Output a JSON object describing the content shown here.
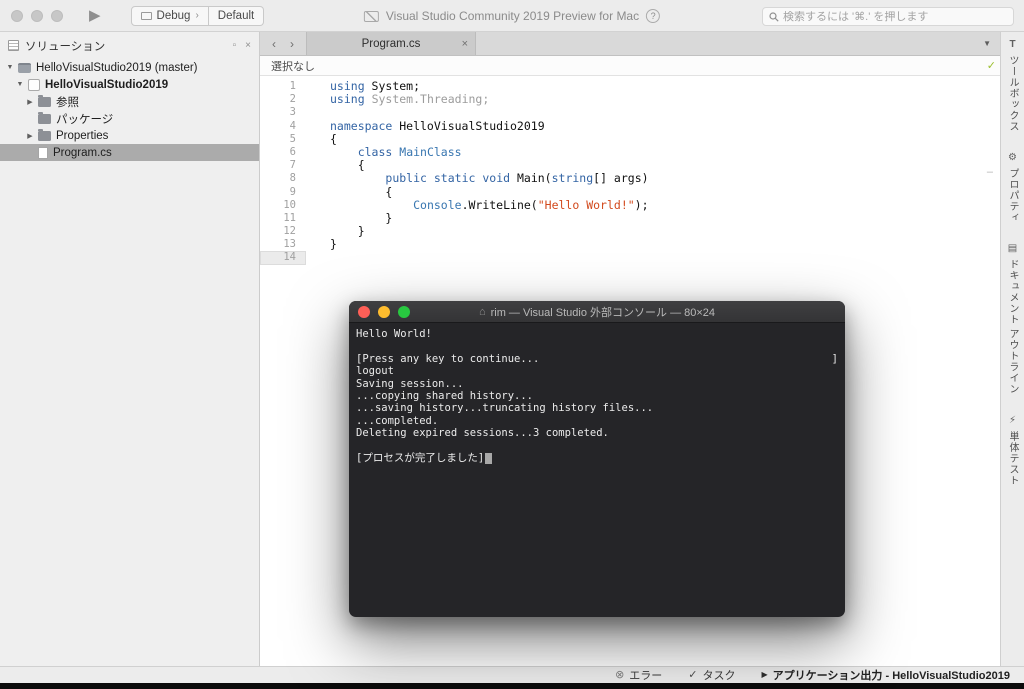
{
  "colors": {
    "kw": "#3364a4",
    "type": "#3876b0",
    "str": "#d2491c",
    "dim": "#9c9c9c",
    "plain": "#111111",
    "selection": "#ababab",
    "check": "#9bbf2e",
    "light-red": "#ff5f57",
    "light-yellow": "#febc2e",
    "light-green": "#28c840"
  },
  "glyphs": {
    "play": "▶",
    "help": "?",
    "back": "‹",
    "forward": "›",
    "close": "×",
    "tab_menu": "▼",
    "dock": "▫",
    "house": "⌂",
    "check": "✓",
    "dash": "–",
    "debug_chevron": "›"
  },
  "titlebar": {
    "title": "Visual Studio Community 2019 Preview for Mac",
    "debug_label": "Debug",
    "config_label": "Default",
    "search_placeholder": "検索するには '⌘.' を押します"
  },
  "sidebar": {
    "header": "ソリューション",
    "tree": [
      {
        "id": "solution",
        "label": "HelloVisualStudio2019 (master)",
        "indent": 0,
        "arrow": "down",
        "icon": "solution"
      },
      {
        "id": "project",
        "label": "HelloVisualStudio2019",
        "indent": 1,
        "arrow": "down",
        "icon": "project",
        "bold": true
      },
      {
        "id": "references",
        "label": "参照",
        "indent": 2,
        "arrow": "right",
        "icon": "folder"
      },
      {
        "id": "packages",
        "label": "パッケージ",
        "indent": 2,
        "arrow": "none",
        "icon": "folder"
      },
      {
        "id": "properties",
        "label": "Properties",
        "indent": 2,
        "arrow": "right",
        "icon": "folder"
      },
      {
        "id": "program-cs",
        "label": "Program.cs",
        "indent": 2,
        "arrow": "none",
        "icon": "file",
        "selected": true
      }
    ]
  },
  "editor": {
    "tab_title": "Program.cs",
    "breadcrumb": "選択なし",
    "lines": [
      {
        "n": 1,
        "tokens": [
          {
            "c": "kw",
            "t": "using"
          },
          {
            "c": "plain",
            "t": " System;"
          }
        ]
      },
      {
        "n": 2,
        "tokens": [
          {
            "c": "kw",
            "t": "using"
          },
          {
            "c": "plain",
            "t": " "
          },
          {
            "c": "dim",
            "t": "System.Threading;"
          }
        ]
      },
      {
        "n": 3,
        "tokens": []
      },
      {
        "n": 4,
        "tokens": [
          {
            "c": "kw",
            "t": "namespace"
          },
          {
            "c": "plain",
            "t": " HelloVisualStudio2019"
          }
        ]
      },
      {
        "n": 5,
        "tokens": [
          {
            "c": "plain",
            "t": "{"
          }
        ]
      },
      {
        "n": 6,
        "tokens": [
          {
            "c": "plain",
            "t": "    "
          },
          {
            "c": "kw",
            "t": "class"
          },
          {
            "c": "plain",
            "t": " "
          },
          {
            "c": "type",
            "t": "MainClass"
          }
        ]
      },
      {
        "n": 7,
        "tokens": [
          {
            "c": "plain",
            "t": "    {"
          }
        ]
      },
      {
        "n": 8,
        "tokens": [
          {
            "c": "plain",
            "t": "        "
          },
          {
            "c": "kw",
            "t": "public"
          },
          {
            "c": "plain",
            "t": " "
          },
          {
            "c": "kw",
            "t": "static"
          },
          {
            "c": "plain",
            "t": " "
          },
          {
            "c": "kw",
            "t": "void"
          },
          {
            "c": "plain",
            "t": " Main("
          },
          {
            "c": "kw",
            "t": "string"
          },
          {
            "c": "plain",
            "t": "[] args)"
          }
        ]
      },
      {
        "n": 9,
        "tokens": [
          {
            "c": "plain",
            "t": "        {"
          }
        ]
      },
      {
        "n": 10,
        "tokens": [
          {
            "c": "plain",
            "t": "            "
          },
          {
            "c": "type",
            "t": "Console"
          },
          {
            "c": "plain",
            "t": ".WriteLine("
          },
          {
            "c": "str",
            "t": "\"Hello World!\""
          },
          {
            "c": "plain",
            "t": ");"
          }
        ]
      },
      {
        "n": 11,
        "tokens": [
          {
            "c": "plain",
            "t": "        }"
          }
        ]
      },
      {
        "n": 12,
        "tokens": [
          {
            "c": "plain",
            "t": "    }"
          }
        ]
      },
      {
        "n": 13,
        "tokens": [
          {
            "c": "plain",
            "t": "}"
          }
        ]
      },
      {
        "n": 14,
        "tokens": [],
        "current": true
      }
    ]
  },
  "terminal": {
    "title": "rim — Visual Studio 外部コンソール — 80×24",
    "lines": [
      {
        "text": "Hello World!"
      },
      {
        "text": ""
      },
      {
        "text": "[Press any key to continue...",
        "right": "]"
      },
      {
        "text": "logout"
      },
      {
        "text": "Saving session..."
      },
      {
        "text": "...copying shared history..."
      },
      {
        "text": "...saving history...truncating history files..."
      },
      {
        "text": "...completed."
      },
      {
        "text": "Deleting expired sessions...3 completed."
      },
      {
        "text": ""
      },
      {
        "text": "[プロセスが完了しました]",
        "cursor": true
      }
    ]
  },
  "rightrail": {
    "items": [
      {
        "id": "toolbox",
        "glyph": "T",
        "label": "ツールボックス"
      },
      {
        "id": "properties",
        "glyph": "⚙",
        "label": "プロパティ"
      },
      {
        "id": "document-outline",
        "glyph": "▤",
        "label": "ドキュメント アウトライン"
      },
      {
        "id": "unit-tests",
        "glyph": "⚡",
        "label": "単体テスト"
      }
    ]
  },
  "statusbar": {
    "items": [
      {
        "id": "errors",
        "icon": "error",
        "glyph": "⊗",
        "label": "エラー"
      },
      {
        "id": "tasks",
        "icon": "tasks",
        "glyph": "✓",
        "label": "タスク"
      },
      {
        "id": "application-output",
        "icon": "play",
        "glyph": "▶",
        "label": "アプリケーション出力 - HelloVisualStudio2019",
        "bold": true
      }
    ]
  }
}
